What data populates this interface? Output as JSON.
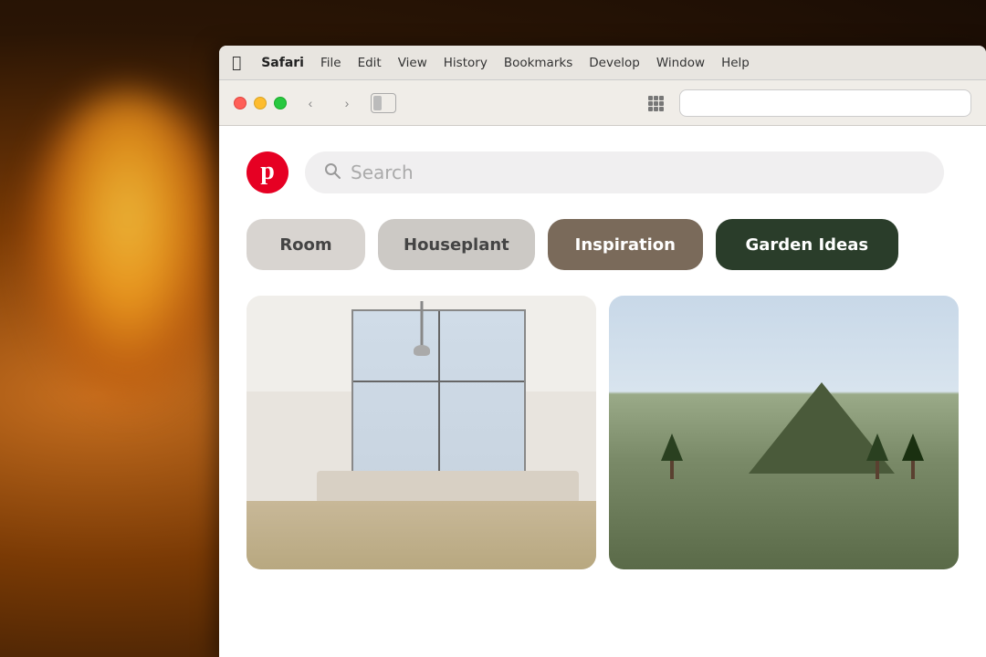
{
  "background": {
    "description": "warm dark amber background with glowing bulb"
  },
  "menubar": {
    "apple_symbol": "⌘",
    "app_name": "Safari",
    "items": [
      "File",
      "Edit",
      "View",
      "History",
      "Bookmarks",
      "Develop",
      "Window",
      "Help"
    ]
  },
  "browser": {
    "back_btn": "‹",
    "forward_btn": "›"
  },
  "pinterest": {
    "logo_letter": "p",
    "search_placeholder": "Search",
    "categories": [
      {
        "label": "Room",
        "style": "light"
      },
      {
        "label": "Houseplant",
        "style": "light"
      },
      {
        "label": "Inspiration",
        "style": "dark-warm"
      },
      {
        "label": "Garden Ideas",
        "style": "dark-green"
      }
    ]
  },
  "colors": {
    "pinterest_red": "#e60023",
    "pill_room": "#d8d4d0",
    "pill_houseplant": "#ccc9c5",
    "pill_inspiration": "#7a6a5a",
    "pill_garden": "#2a3d2a",
    "search_bg": "#f0eff0"
  }
}
